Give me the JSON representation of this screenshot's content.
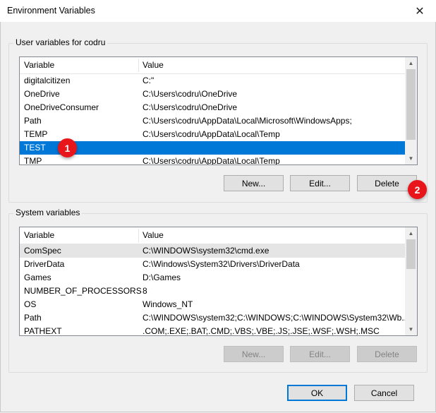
{
  "window": {
    "title": "Environment Variables",
    "close_glyph": "✕"
  },
  "user_group": {
    "legend": "User variables for codru",
    "header": {
      "variable": "Variable",
      "value": "Value"
    },
    "rows": [
      {
        "variable": "digitalcitizen",
        "value": "C:\""
      },
      {
        "variable": "OneDrive",
        "value": "C:\\Users\\codru\\OneDrive"
      },
      {
        "variable": "OneDriveConsumer",
        "value": "C:\\Users\\codru\\OneDrive"
      },
      {
        "variable": "Path",
        "value": "C:\\Users\\codru\\AppData\\Local\\Microsoft\\WindowsApps;"
      },
      {
        "variable": "TEMP",
        "value": "C:\\Users\\codru\\AppData\\Local\\Temp"
      },
      {
        "variable": "TEST",
        "value": ""
      },
      {
        "variable": "TMP",
        "value": "C:\\Users\\codru\\AppData\\Local\\Temp"
      }
    ],
    "buttons": {
      "new": "New...",
      "edit": "Edit...",
      "delete": "Delete"
    }
  },
  "system_group": {
    "legend": "System variables",
    "header": {
      "variable": "Variable",
      "value": "Value"
    },
    "rows": [
      {
        "variable": "ComSpec",
        "value": "C:\\WINDOWS\\system32\\cmd.exe"
      },
      {
        "variable": "DriverData",
        "value": "C:\\Windows\\System32\\Drivers\\DriverData"
      },
      {
        "variable": "Games",
        "value": "D:\\Games"
      },
      {
        "variable": "NUMBER_OF_PROCESSORS",
        "value": "8"
      },
      {
        "variable": "OS",
        "value": "Windows_NT"
      },
      {
        "variable": "Path",
        "value": "C:\\WINDOWS\\system32;C:\\WINDOWS;C:\\WINDOWS\\System32\\Wb..."
      },
      {
        "variable": "PATHEXT",
        "value": ".COM;.EXE;.BAT;.CMD;.VBS;.VBE;.JS;.JSE;.WSF;.WSH;.MSC"
      }
    ],
    "buttons": {
      "new": "New...",
      "edit": "Edit...",
      "delete": "Delete"
    }
  },
  "footer": {
    "ok": "OK",
    "cancel": "Cancel"
  },
  "annotations": {
    "badge1": "1",
    "badge2": "2"
  },
  "colors": {
    "selection": "#0078d7",
    "badge": "#e8161b"
  },
  "icons": {
    "scroll_up": "▲",
    "scroll_down": "▼"
  }
}
